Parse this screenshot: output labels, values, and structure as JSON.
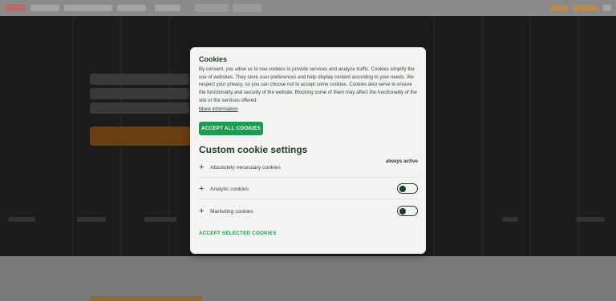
{
  "cookie_modal": {
    "title": "Cookies",
    "description": "By consent, you allow us to use cookies to provide services and analyze traffic. Cookies simplify the use of websites. They store user preferences and help display content according to your needs. We respect your privacy, so you can choose not to accept some cookies. Cookies also serve to ensure the functionality and security of the website. Blocking some of them may affect the functionality of the site or the services offered.",
    "more_info_link": "More information",
    "accept_all_button": "ACCEPT ALL COOKIES",
    "custom_settings_heading": "Custom cookie settings",
    "categories": [
      {
        "label": "Absolutely necessary cookies",
        "status": "always active"
      },
      {
        "label": "Analytic cookies",
        "enabled": false
      },
      {
        "label": "Marketing cookies",
        "enabled": false
      }
    ],
    "accept_selected_button": "ACCEPT SELECTED COOKIES"
  },
  "icons": {
    "expand": "plus-icon",
    "toggle": "toggle-switch"
  },
  "colors": {
    "accent_green": "#1f9a52",
    "text_dark_green": "#1f3d2e",
    "modal_background": "#f3f3f1",
    "overlay_hero": "#1c1c1c",
    "brand_orange_dimmed": "#6b3d12"
  }
}
